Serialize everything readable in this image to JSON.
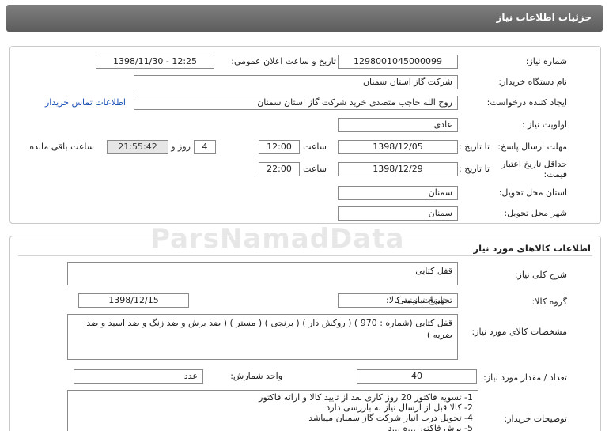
{
  "header": {
    "title": "جزئیات اطلاعات نیاز"
  },
  "need_info": {
    "need_number_label": "شماره نیاز:",
    "need_number": "1298001045000099",
    "announce_label": "تاریخ و ساعت اعلان عمومی:",
    "announce_value": "1398/11/30 - 12:25",
    "buyer_org_label": "نام دستگاه خریدار:",
    "buyer_org": "شرکت گاز استان سمنان",
    "requester_label": "ایجاد کننده درخواست:",
    "requester": "روح الله  حاجب متصدی خرید شرکت گاز استان سمنان",
    "contact_link": "اطلاعات تماس خریدار",
    "priority_label": "اولویت نیاز :",
    "priority": "عادی",
    "deadline_label": "مهلت ارسال پاسخ:",
    "until_date_label": "تا تاریخ :",
    "deadline_date": "1398/12/05",
    "time_label": "ساعت",
    "deadline_time": "12:00",
    "days_value": "4",
    "days_label": "روز و",
    "remaining_time": "21:55:42",
    "remaining_label": "ساعت باقی مانده",
    "validity_label": "حداقل تاریخ اعتبار قیمت:",
    "validity_date": "1398/12/29",
    "validity_time": "22:00",
    "province_label": "استان محل تحویل:",
    "province": "سمنان",
    "city_label": "شهر محل تحویل:",
    "city": "سمنان"
  },
  "goods": {
    "section_title": "اطلاعات کالاهای مورد نیاز",
    "summary_label": "شرح کلی نیاز:",
    "summary": "قفل کتابی",
    "group_label": "گروه کالا:",
    "group": "تجهیزات امنیتی",
    "need_date_label": "تاریخ نیاز به کالا:",
    "need_date": "1398/12/15",
    "specs_label": "مشخصات کالای مورد نیاز:",
    "specs": "قفل کتابی (شماره : 970 ) ( روکش دار ) ( برنجی ) ( مستر ) ( ضد برش و ضد زنگ و ضد اسید و ضد ضربه )",
    "qty_label": "تعداد / مقدار مورد نیاز:",
    "qty": "40",
    "unit_label": "واحد شمارش:",
    "unit": "عدد",
    "buyer_notes_label": "توضیحات خریدار:",
    "notes": [
      "1- تسویه فاکتور 20 روز کاری بعد از تایید کالا و ارائه فاکتور",
      "2- کالا قبل از ارسال نیاز به بازرسی دارد",
      "4- تحویل درب انبار شرکت گاز سمنان میباشد",
      "5- برش فاکتور ...ه ...د"
    ]
  },
  "watermark": "ParsNamadData"
}
